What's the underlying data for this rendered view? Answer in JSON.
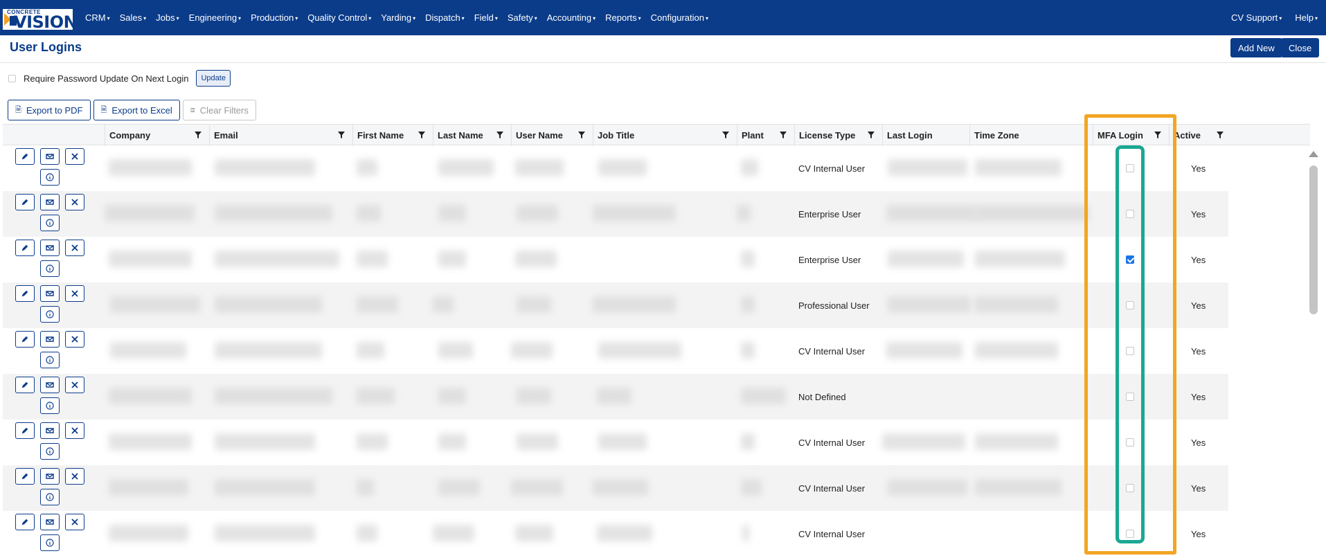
{
  "brand": {
    "logo_small": "CONCRETE",
    "logo_big": "VISION"
  },
  "nav": {
    "items": [
      "CRM",
      "Sales",
      "Jobs",
      "Engineering",
      "Production",
      "Quality Control",
      "Yarding",
      "Dispatch",
      "Field",
      "Safety",
      "Accounting",
      "Reports",
      "Configuration"
    ],
    "right": [
      "CV Support",
      "Help"
    ]
  },
  "page": {
    "title": "User Logins",
    "add_new": "Add New",
    "close": "Close"
  },
  "password": {
    "label": "Require Password Update On Next Login",
    "update": "Update"
  },
  "toolbar": {
    "export_pdf": "Export to PDF",
    "export_excel": "Export to Excel",
    "clear_filters": "Clear Filters"
  },
  "columns": [
    "Company",
    "Email",
    "First Name",
    "Last Name",
    "User Name",
    "Job Title",
    "Plant",
    "License Type",
    "Last Login",
    "Time Zone",
    "MFA Login",
    "Active"
  ],
  "rows": [
    {
      "license": "CV Internal User",
      "active": "Yes",
      "mfa": false
    },
    {
      "license": "Enterprise User",
      "active": "Yes",
      "mfa": false
    },
    {
      "license": "Enterprise User",
      "active": "Yes",
      "mfa": true
    },
    {
      "license": "Professional User",
      "active": "Yes",
      "mfa": false
    },
    {
      "license": "CV Internal User",
      "active": "Yes",
      "mfa": false
    },
    {
      "license": "Not Defined",
      "active": "Yes",
      "mfa": false
    },
    {
      "license": "CV Internal User",
      "active": "Yes",
      "mfa": false
    },
    {
      "license": "CV Internal User",
      "active": "Yes",
      "mfa": false
    },
    {
      "license": "CV Internal User",
      "active": "Yes",
      "mfa": false
    }
  ],
  "colors": {
    "brand_blue": "#0b3c8a",
    "highlight_orange": "#f2a623",
    "highlight_teal": "#1aa894",
    "checkbox_checked": "#1a73e8"
  }
}
